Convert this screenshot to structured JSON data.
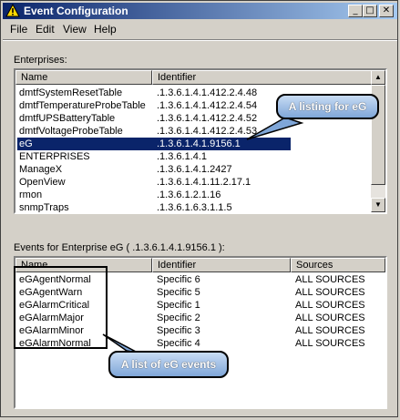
{
  "window": {
    "title": "Event Configuration",
    "minimize": "_",
    "maximize": "□",
    "close": "✕"
  },
  "menu": [
    "File",
    "Edit",
    "View",
    "Help"
  ],
  "enterprises": {
    "label": "Enterprises:",
    "columns": [
      "Name",
      "Identifier"
    ],
    "rows": [
      {
        "name": "dmtfSystemResetTable",
        "id": ".1.3.6.1.4.1.412.2.4.48"
      },
      {
        "name": "dmtfTemperatureProbeTable",
        "id": ".1.3.6.1.4.1.412.2.4.54"
      },
      {
        "name": "dmtfUPSBatteryTable",
        "id": ".1.3.6.1.4.1.412.2.4.52"
      },
      {
        "name": "dmtfVoltageProbeTable",
        "id": ".1.3.6.1.4.1.412.2.4.53"
      },
      {
        "name": "eG",
        "id": ".1.3.6.1.4.1.9156.1"
      },
      {
        "name": "ENTERPRISES",
        "id": ".1.3.6.1.4.1"
      },
      {
        "name": "ManageX",
        "id": ".1.3.6.1.4.1.2427"
      },
      {
        "name": "OpenView",
        "id": ".1.3.6.1.4.1.11.2.17.1"
      },
      {
        "name": "rmon",
        "id": ".1.3.6.1.2.1.16"
      },
      {
        "name": "snmpTraps",
        "id": ".1.3.6.1.6.3.1.1.5"
      }
    ],
    "selected_index": 4
  },
  "events": {
    "label": "Events for Enterprise eG ( .1.3.6.1.4.1.9156.1 ):",
    "columns": [
      "Name",
      "Identifier",
      "Sources"
    ],
    "rows": [
      {
        "name": "eGAgentNormal",
        "id": "Specific 6",
        "src": "ALL SOURCES"
      },
      {
        "name": "eGAgentWarn",
        "id": "Specific 5",
        "src": "ALL SOURCES"
      },
      {
        "name": "eGAlarmCritical",
        "id": "Specific 1",
        "src": "ALL SOURCES"
      },
      {
        "name": "eGAlarmMajor",
        "id": "Specific 2",
        "src": "ALL SOURCES"
      },
      {
        "name": "eGAlarmMinor",
        "id": "Specific 3",
        "src": "ALL SOURCES"
      },
      {
        "name": "eGAlarmNormal",
        "id": "Specific 4",
        "src": "ALL SOURCES"
      }
    ]
  },
  "callouts": {
    "listing": "A listing for eG",
    "events": "A list of eG events"
  },
  "colors": {
    "selection": "#0a246a",
    "callout_fill": "#7fa6d8"
  }
}
